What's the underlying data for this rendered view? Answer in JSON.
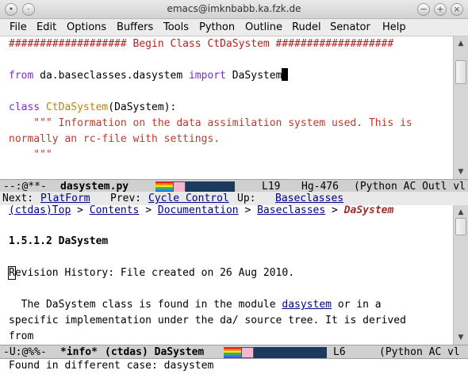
{
  "window": {
    "title": "emacs@imknbabb.ka.fzk.de"
  },
  "menu": [
    "File",
    "Edit",
    "Options",
    "Buffers",
    "Tools",
    "Python",
    "Outline",
    "Rudel",
    "Senator",
    "Help"
  ],
  "code_pane": {
    "lines": [
      "################### Begin Class CtDaSystem ###################",
      "",
      "from da.baseclasses.dasystem import DaSystem",
      "",
      "class CtDaSystem(DaSystem):",
      "    \"\"\" Information on the data assimilation system used. This is",
      "normally an rc-file with settings.",
      "    \"\"\""
    ],
    "kw_from": "from",
    "module": "da.baseclasses.dasystem",
    "kw_import": "import",
    "imported": "DaSystem",
    "kw_class": "class",
    "class_name": "CtDaSystem",
    "class_args": "(DaSystem):"
  },
  "modeline1": {
    "status": "--:@**-",
    "buffer": "dasystem.py",
    "line": "L19",
    "hg": "Hg-476",
    "modes": "(Python AC Outl vl"
  },
  "info_header": {
    "next_label": "Next:",
    "next_link": "PlatForm",
    "prev_label": "Prev:",
    "prev_link": "Cycle Control",
    "up_label": "Up:",
    "up_link": "Baseclasses"
  },
  "info_pane": {
    "breadcrumb": [
      "(ctdas)Top",
      "Contents",
      "Documentation",
      "Baseclasses"
    ],
    "breadcrumb_current": "DaSystem",
    "section_title": "1.5.1.2 DaSystem",
    "revision_first": "R",
    "revision_rest": "evision History: File created on 26 Aug 2010.",
    "para_line1_pre": "  The DaSystem class is found in the module ",
    "para_link": "dasystem",
    "para_line1_post": " or in a",
    "para_line2": "specific implementation under the da/ source tree. It is derived",
    "para_line3": "from"
  },
  "modeline2": {
    "status": "-U:@%%-",
    "buffer": "*info*",
    "node": "(ctdas) DaSystem",
    "line": "L6",
    "modes": "(Python AC vl"
  },
  "echo_area": {
    "message": "Found in different case: dasystem"
  }
}
